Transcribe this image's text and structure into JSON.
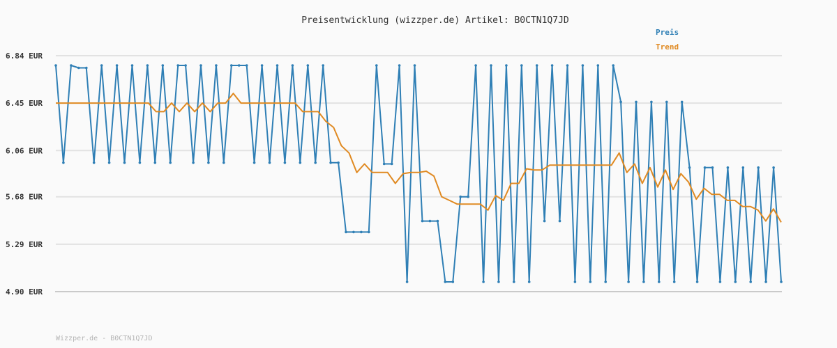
{
  "chart_data": {
    "type": "line",
    "title": "Preisentwicklung (wizzper.de) Artikel: B0CTN1Q7JD",
    "xlabel": "",
    "ylabel": "",
    "ylim": [
      4.9,
      6.84
    ],
    "yticks": [
      4.9,
      5.29,
      5.68,
      6.06,
      6.45,
      6.84
    ],
    "ytick_labels": [
      "4.90 EUR",
      "5.29 EUR",
      "5.68 EUR",
      "6.06 EUR",
      "6.45 EUR",
      "6.84 EUR"
    ],
    "grid": true,
    "legend_position": "top-right",
    "series": [
      {
        "name": "Preis",
        "color": "#2f7fb5",
        "values": [
          6.76,
          5.96,
          6.76,
          6.74,
          6.74,
          5.96,
          6.76,
          5.96,
          6.76,
          5.96,
          6.76,
          5.96,
          6.76,
          5.96,
          6.76,
          5.96,
          6.76,
          6.76,
          5.96,
          6.76,
          5.96,
          6.76,
          5.96,
          6.76,
          6.76,
          6.76,
          5.96,
          6.76,
          5.96,
          6.76,
          5.96,
          6.76,
          5.96,
          6.76,
          5.96,
          6.76,
          5.96,
          5.96,
          5.39,
          5.39,
          5.39,
          5.39,
          6.76,
          5.95,
          5.95,
          6.76,
          4.98,
          6.76,
          5.48,
          5.48,
          5.48,
          4.98,
          4.98,
          5.68,
          5.68,
          6.76,
          4.98,
          6.76,
          4.98,
          6.76,
          4.98,
          6.76,
          4.98,
          6.76,
          5.48,
          6.76,
          5.48,
          6.76,
          4.98,
          6.76,
          4.98,
          6.76,
          4.98,
          6.76,
          6.46,
          4.98,
          6.46,
          4.98,
          6.46,
          4.98,
          6.46,
          4.98,
          6.46,
          5.92,
          4.98,
          5.92,
          5.92,
          4.98,
          5.92,
          4.98,
          5.92,
          4.98,
          5.92,
          4.98,
          5.92,
          4.98
        ]
      },
      {
        "name": "Trend",
        "color": "#e08a22",
        "values": [
          6.45,
          6.45,
          6.45,
          6.45,
          6.45,
          6.45,
          6.45,
          6.45,
          6.45,
          6.45,
          6.45,
          6.45,
          6.45,
          6.38,
          6.38,
          6.45,
          6.38,
          6.45,
          6.38,
          6.45,
          6.38,
          6.45,
          6.45,
          6.53,
          6.45,
          6.45,
          6.45,
          6.45,
          6.45,
          6.45,
          6.45,
          6.45,
          6.38,
          6.38,
          6.38,
          6.3,
          6.25,
          6.1,
          6.04,
          5.88,
          5.95,
          5.88,
          5.88,
          5.88,
          5.79,
          5.87,
          5.88,
          5.88,
          5.89,
          5.85,
          5.68,
          5.65,
          5.62,
          5.62,
          5.62,
          5.62,
          5.57,
          5.69,
          5.65,
          5.79,
          5.79,
          5.91,
          5.9,
          5.9,
          5.94,
          5.94,
          5.94,
          5.94,
          5.94,
          5.94,
          5.94,
          5.94,
          5.94,
          6.04,
          5.88,
          5.95,
          5.79,
          5.92,
          5.76,
          5.9,
          5.74,
          5.87,
          5.8,
          5.66,
          5.75,
          5.7,
          5.7,
          5.65,
          5.65,
          5.6,
          5.6,
          5.57,
          5.48,
          5.58,
          5.47
        ]
      }
    ]
  },
  "footer": "Wizzper.de - B0CTN1Q7JD"
}
